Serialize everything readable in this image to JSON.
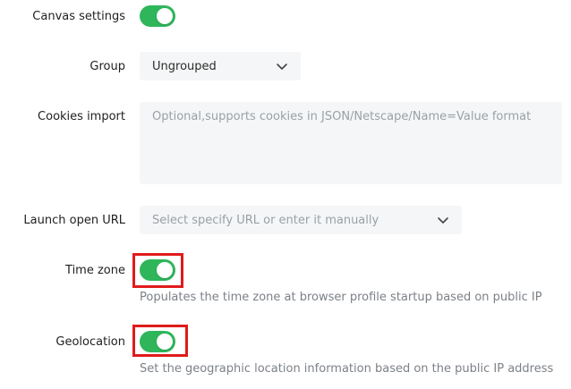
{
  "colors": {
    "toggle_on": "#2fb65b",
    "highlight": "#e01b1b"
  },
  "canvas_settings": {
    "label": "Canvas settings",
    "enabled": true
  },
  "group": {
    "label": "Group",
    "value": "Ungrouped",
    "icon": "chevron-down-icon"
  },
  "cookies_import": {
    "label": "Cookies import",
    "placeholder": "Optional,supports cookies in JSON/Netscape/Name=Value format"
  },
  "launch_open_url": {
    "label": "Launch open URL",
    "placeholder": "Select specify URL or enter it manually",
    "icon": "chevron-down-icon"
  },
  "time_zone": {
    "label": "Time zone",
    "enabled": true,
    "hint": "Populates the time zone at browser profile startup based on public IP"
  },
  "geolocation": {
    "label": "Geolocation",
    "enabled": true,
    "hint": "Set the geographic location information based on the public IP address"
  }
}
